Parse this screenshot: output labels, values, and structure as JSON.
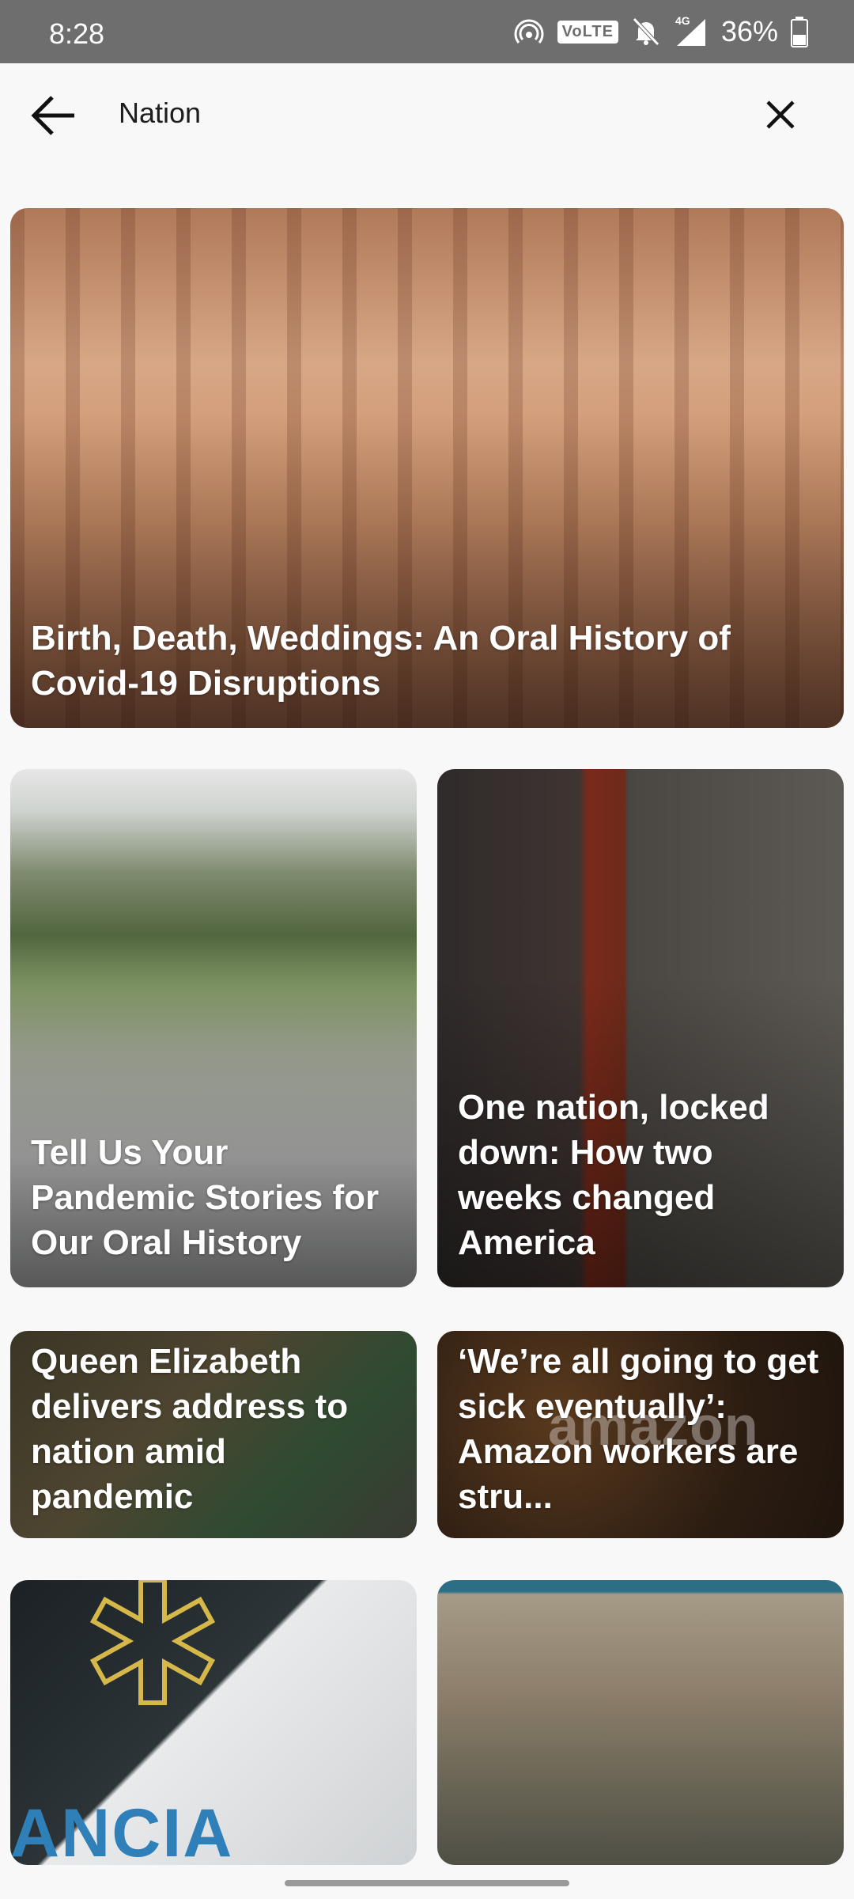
{
  "status_bar": {
    "time": "8:28",
    "network_badge": "VoLTE",
    "signal_label": "4G",
    "battery": "36%",
    "icons": [
      "hotspot-icon",
      "volte-icon",
      "mute-icon",
      "signal-icon",
      "battery-icon"
    ]
  },
  "app_bar": {
    "query": "Nation",
    "back_icon": "arrow-left-icon",
    "clear_icon": "close-icon"
  },
  "results": [
    {
      "title": "Birth, Death, Weddings: An Oral History of Covid-19 Disruptions"
    },
    {
      "title": "Tell Us Your Pandemic Stories for Our Oral History"
    },
    {
      "title": "One nation, locked down: How two weeks changed America"
    },
    {
      "title": "Queen Elizabeth delivers address to nation amid pandemic"
    },
    {
      "title": "‘We’re all going to get sick eventually’: Amazon workers are stru..."
    },
    {
      "title": ""
    },
    {
      "title": ""
    }
  ],
  "image_text": {
    "amazon": "amazon",
    "ambulance": "ANCIA"
  },
  "colors": {
    "status_bar": "#6e6e6e",
    "background": "#f8f8f8",
    "text_dark": "#1d1d1d"
  }
}
